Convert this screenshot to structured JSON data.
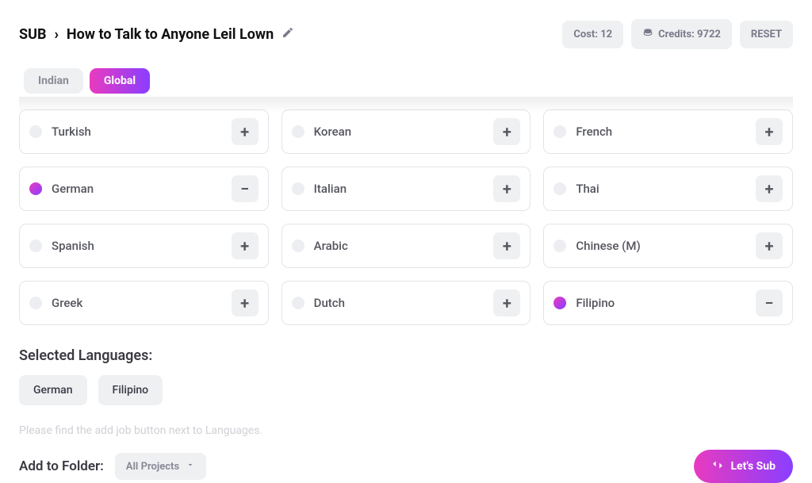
{
  "header": {
    "sub_label": "SUB",
    "title": "How to Talk to Anyone Leil Lown",
    "cost_label": "Cost: 12",
    "credits_label": "Credits: 9722",
    "reset_label": "RESET"
  },
  "tabs": {
    "indian": "Indian",
    "global": "Global",
    "active": "global"
  },
  "languages": [
    {
      "name": "Turkish",
      "selected": false
    },
    {
      "name": "Korean",
      "selected": false
    },
    {
      "name": "French",
      "selected": false
    },
    {
      "name": "German",
      "selected": true
    },
    {
      "name": "Italian",
      "selected": false
    },
    {
      "name": "Thai",
      "selected": false
    },
    {
      "name": "Spanish",
      "selected": false
    },
    {
      "name": "Arabic",
      "selected": false
    },
    {
      "name": "Chinese (M)",
      "selected": false
    },
    {
      "name": "Greek",
      "selected": false
    },
    {
      "name": "Dutch",
      "selected": false
    },
    {
      "name": "Filipino",
      "selected": true
    }
  ],
  "selected_section": {
    "title": "Selected Languages:",
    "items": [
      "German",
      "Filipino"
    ]
  },
  "hint": "Please find the add job button next to Languages.",
  "footer": {
    "folder_label": "Add to Folder:",
    "dropdown_label": "All Projects",
    "primary_label": "Let's Sub"
  },
  "icons": {
    "plus": "+",
    "minus": "−",
    "chevron_right": "›"
  }
}
